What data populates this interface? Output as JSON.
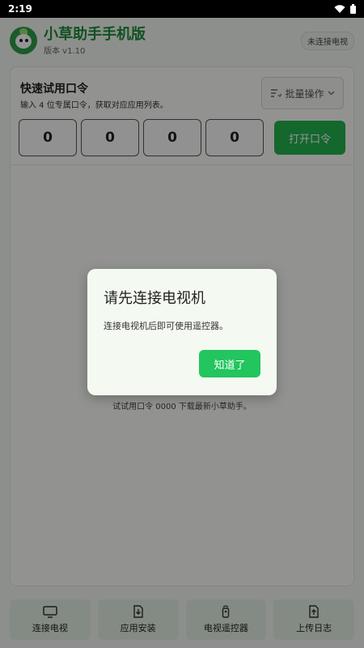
{
  "status_bar": {
    "time": "2:19"
  },
  "header": {
    "title": "小草助手手机版",
    "version": "版本 v1.10",
    "tv_status": "未连接电视"
  },
  "quick_try": {
    "title": "快速试用口令",
    "subtitle": "输入 4 位专属口令，获取对应应用列表。",
    "batch_label": "批量操作",
    "digits": [
      "0",
      "0",
      "0",
      "0"
    ],
    "open_label": "打开口令",
    "hint": "试试用口令 0000 下载最新小草助手。"
  },
  "bottom_nav": [
    {
      "label": "连接电视",
      "icon": "tv-icon"
    },
    {
      "label": "应用安装",
      "icon": "install-icon"
    },
    {
      "label": "电视遥控器",
      "icon": "remote-icon"
    },
    {
      "label": "上传日志",
      "icon": "upload-log-icon"
    }
  ],
  "dialog": {
    "title": "请先连接电视机",
    "message": "连接电视机后即可使用遥控器。",
    "confirm_label": "知道了"
  },
  "colors": {
    "brand_green": "#1f8b3a",
    "button_green": "#22c55e",
    "dialog_bg": "#f4faf1"
  }
}
